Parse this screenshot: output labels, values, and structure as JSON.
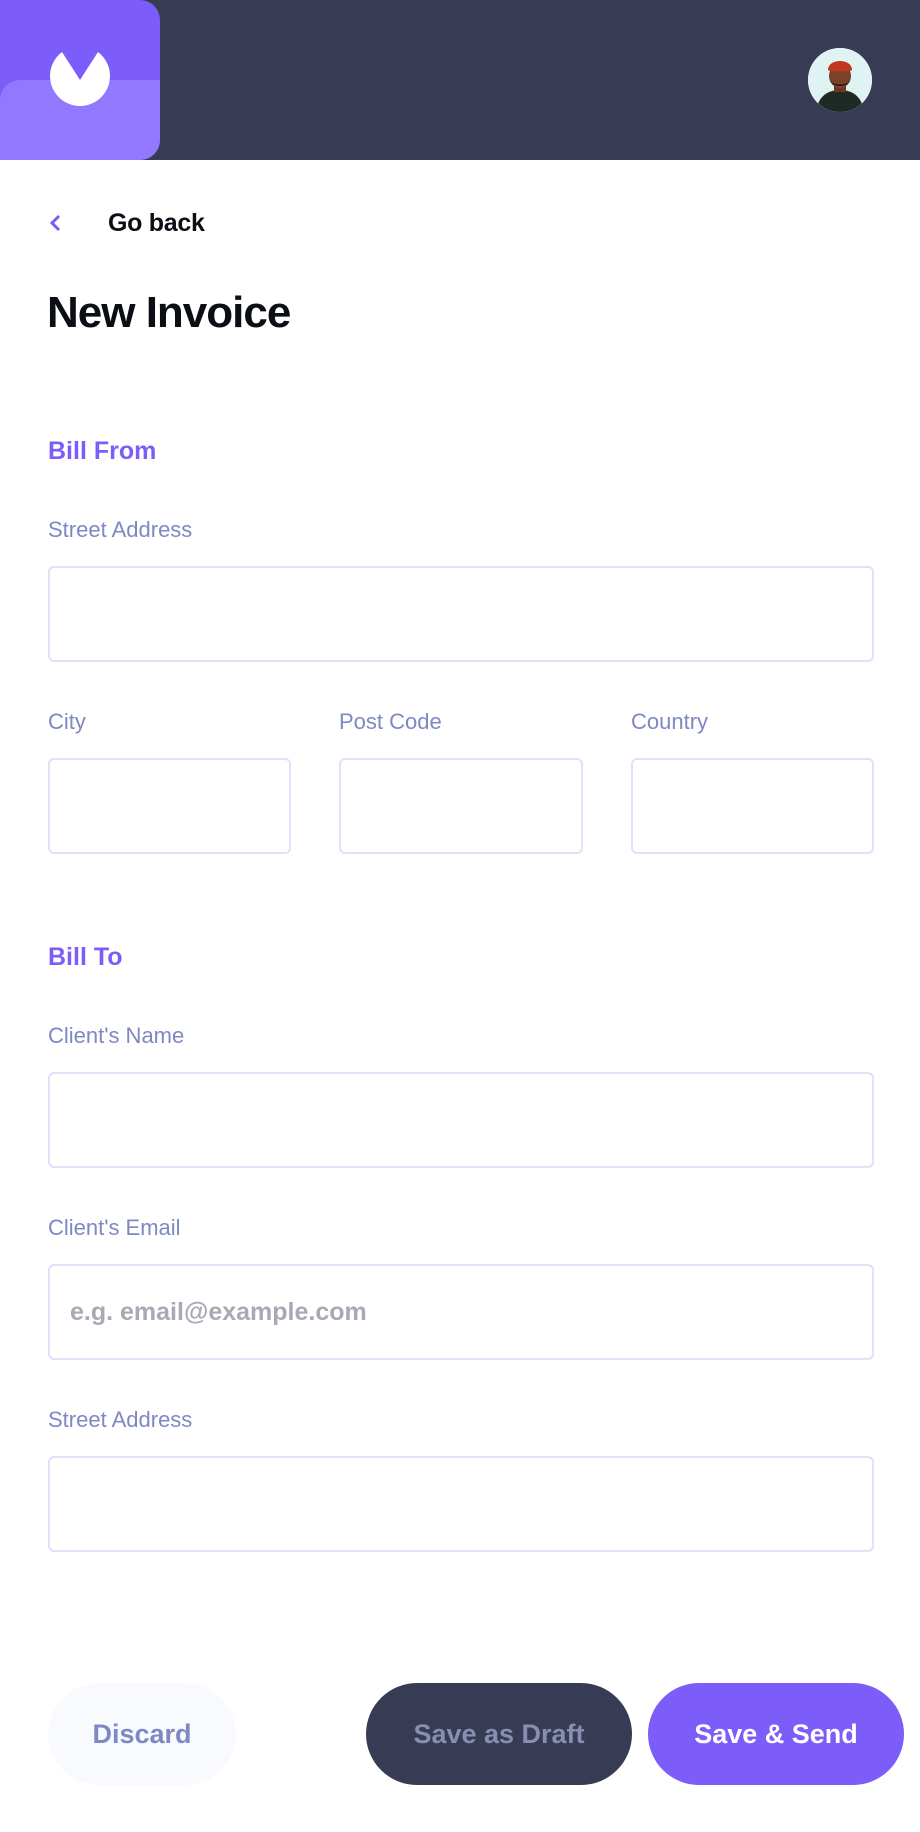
{
  "header": {
    "logo_icon": "brand-logo-icon",
    "avatar_icon": "user-avatar",
    "brand_color": "#7c5dfa",
    "bar_color": "#373b53"
  },
  "nav": {
    "back_label": "Go back",
    "back_icon": "chevron-left-icon"
  },
  "page": {
    "title": "New Invoice"
  },
  "bill_from": {
    "title": "Bill From",
    "street_label": "Street Address",
    "street_value": "",
    "city_label": "City",
    "city_value": "",
    "post_code_label": "Post Code",
    "post_code_value": "",
    "country_label": "Country",
    "country_value": ""
  },
  "bill_to": {
    "title": "Bill To",
    "client_name_label": "Client's Name",
    "client_name_value": "",
    "client_email_label": "Client's Email",
    "client_email_placeholder": "e.g. email@example.com",
    "street_label": "Street Address",
    "street_value": ""
  },
  "actions": {
    "discard_label": "Discard",
    "draft_label": "Save as Draft",
    "send_label": "Save & Send"
  }
}
